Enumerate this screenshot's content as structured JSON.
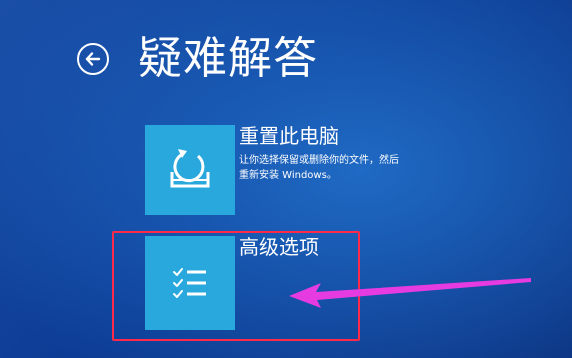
{
  "header": {
    "title": "疑难解答",
    "back_icon": "back-arrow-icon"
  },
  "options": [
    {
      "title": "重置此电脑",
      "description_line1": "让你选择保留或删除你的文件，然后",
      "description_line2": "重新安装 Windows。",
      "icon": "reset-pc-icon"
    },
    {
      "title": "高级选项",
      "icon": "checklist-icon"
    }
  ],
  "colors": {
    "background": "#0d3c95",
    "tile": "#29a8de",
    "highlight": "#ff2a4a",
    "arrow": "#e63be0"
  }
}
